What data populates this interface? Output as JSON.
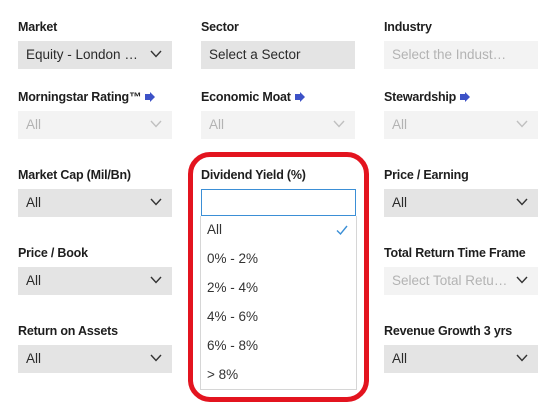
{
  "filters": {
    "market": {
      "label": "Market",
      "value": "Equity - London Sto…"
    },
    "sector": {
      "label": "Sector",
      "value": "Select a Sector"
    },
    "industry": {
      "label": "Industry",
      "value": "Select the Industries"
    },
    "morningstar_rating": {
      "label": "Morningstar Rating™",
      "value": "All"
    },
    "economic_moat": {
      "label": "Economic Moat",
      "value": "All"
    },
    "stewardship": {
      "label": "Stewardship",
      "value": "All"
    },
    "market_cap": {
      "label": "Market Cap (Mil/Bn)",
      "value": "All"
    },
    "dividend_yield": {
      "label": "Dividend Yield (%)",
      "value": ""
    },
    "price_earning": {
      "label": "Price / Earning",
      "value": "All"
    },
    "price_book": {
      "label": "Price / Book",
      "value": "All"
    },
    "total_return_time_frame": {
      "label": "Total Return Time Frame",
      "value": "Select Total Return …"
    },
    "return_on_assets": {
      "label": "Return on Assets",
      "value": "All"
    },
    "revenue_growth": {
      "label": "Revenue Growth 3 yrs",
      "value": "All"
    }
  },
  "dividend_yield_dropdown": {
    "options": [
      "All",
      "0% - 2%",
      "2% - 4%",
      "4% - 6%",
      "6% - 8%",
      "> 8%"
    ],
    "selected": "All"
  },
  "colors": {
    "highlight": "#e3141f",
    "checkmark": "#3b8fd6",
    "info_icon": "#3d52c7",
    "select_bg": "#e4e4e4",
    "disabled_bg": "#f3f3f3"
  },
  "icons": {
    "info": "info-arrow-icon",
    "chevron": "chevron-down-icon",
    "check": "checkmark-icon"
  }
}
